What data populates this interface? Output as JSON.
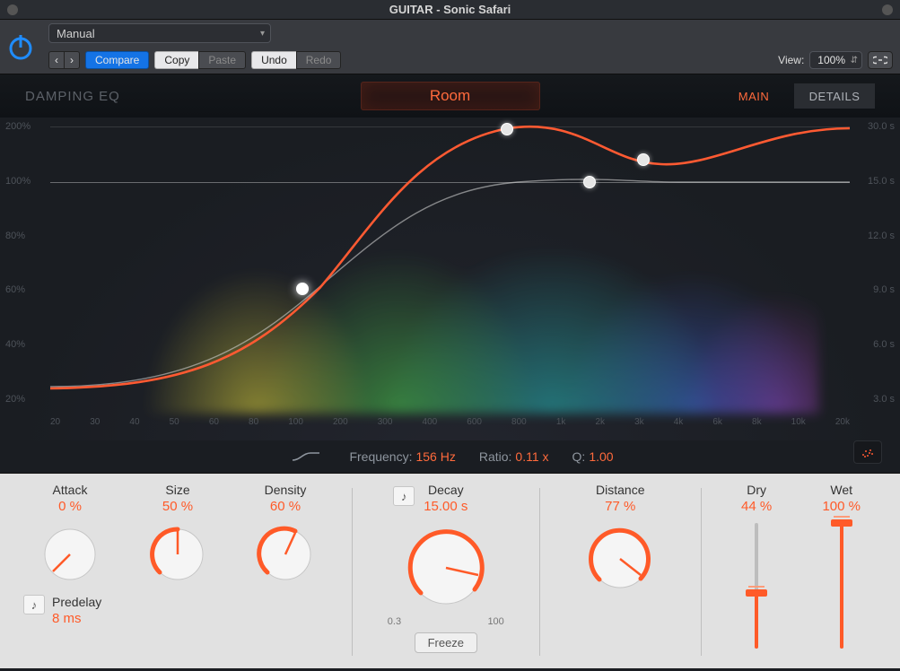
{
  "window": {
    "title": "GUITAR - Sonic Safari"
  },
  "toolbar": {
    "preset": "Manual",
    "back": "‹",
    "fwd": "›",
    "compare": "Compare",
    "copy": "Copy",
    "paste": "Paste",
    "undo": "Undo",
    "redo": "Redo",
    "view_label": "View:",
    "zoom": "100%"
  },
  "header": {
    "eq_label": "DAMPING EQ",
    "mode": "Room",
    "tab_main": "MAIN",
    "tab_details": "DETAILS"
  },
  "axes": {
    "left": [
      "200%",
      "100%",
      "80%",
      "60%",
      "40%",
      "20%"
    ],
    "right": [
      "30.0 s",
      "15.0 s",
      "12.0 s",
      "9.0 s",
      "6.0 s",
      "3.0 s"
    ],
    "bottom": [
      "20",
      "30",
      "40",
      "50",
      "60",
      "80",
      "100",
      "200",
      "300",
      "400",
      "600",
      "800",
      "1k",
      "2k",
      "3k",
      "4k",
      "6k",
      "8k",
      "10k",
      "20k"
    ]
  },
  "band": {
    "freq_label": "Frequency:",
    "freq_value": "156 Hz",
    "ratio_label": "Ratio:",
    "ratio_value": "0.11 x",
    "q_label": "Q:",
    "q_value": "1.00"
  },
  "controls": {
    "attack": {
      "label": "Attack",
      "value": "0 %",
      "pct": 0
    },
    "size": {
      "label": "Size",
      "value": "50 %",
      "pct": 50
    },
    "density": {
      "label": "Density",
      "value": "60 %",
      "pct": 60
    },
    "predelay": {
      "label": "Predelay",
      "value": "8 ms"
    },
    "decay": {
      "label": "Decay",
      "value": "15.00 s",
      "pct": 58,
      "scale_lo": "0.3",
      "scale_hi": "100",
      "freeze": "Freeze"
    },
    "distance": {
      "label": "Distance",
      "value": "77 %",
      "pct": 77
    },
    "dry": {
      "label": "Dry",
      "value": "44 %",
      "pct": 44
    },
    "wet": {
      "label": "Wet",
      "value": "100 %",
      "pct": 100
    }
  }
}
